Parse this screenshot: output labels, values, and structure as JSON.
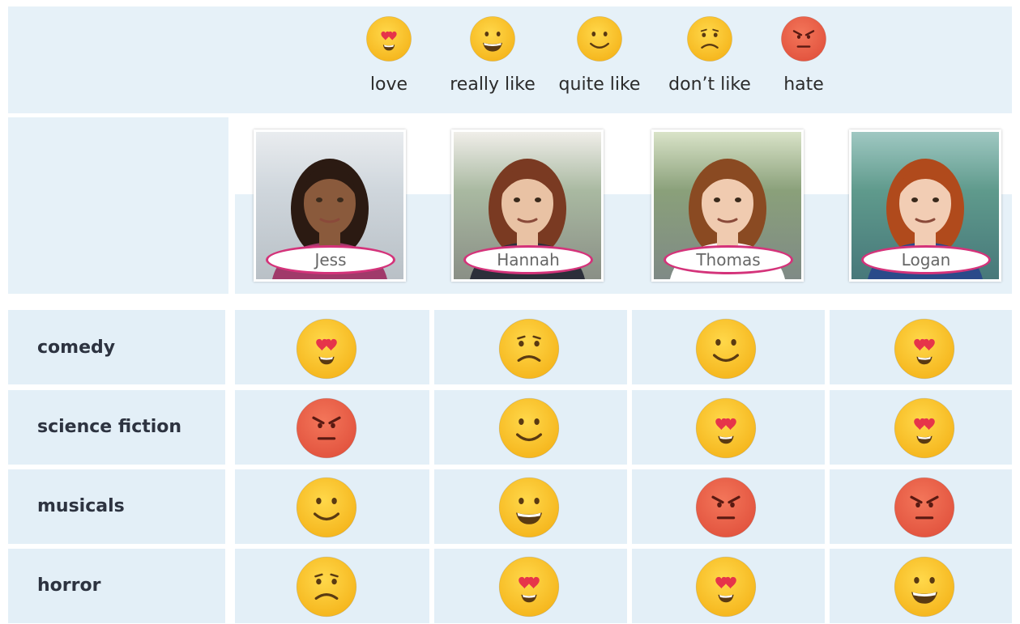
{
  "legend": [
    {
      "key": "love",
      "label": "love",
      "face": "heart-eyes-face-icon"
    },
    {
      "key": "really_like",
      "label": "really like",
      "face": "grinning-face-icon"
    },
    {
      "key": "quite_like",
      "label": "quite like",
      "face": "smiling-face-icon"
    },
    {
      "key": "dont_like",
      "label": "don’t like",
      "face": "frowning-face-icon"
    },
    {
      "key": "hate",
      "label": "hate",
      "face": "angry-face-icon"
    }
  ],
  "people": [
    {
      "name": "Jess"
    },
    {
      "name": "Hannah"
    },
    {
      "name": "Thomas"
    },
    {
      "name": "Logan"
    }
  ],
  "genres": [
    "comedy",
    "science fiction",
    "musicals",
    "horror"
  ],
  "ratings": [
    [
      "love",
      "dont_like",
      "quite_like",
      "love"
    ],
    [
      "hate",
      "quite_like",
      "love",
      "love"
    ],
    [
      "quite_like",
      "really_like",
      "hate",
      "hate"
    ],
    [
      "dont_like",
      "love",
      "love",
      "really_like"
    ]
  ],
  "colors": {
    "yellow": "#f5b51c",
    "yellow_light": "#ffd84a",
    "red": "#e2533e",
    "red_light": "#f3765a",
    "heart": "#e6344a",
    "name_border": "#d4337a",
    "panel": "#e6f1f8"
  }
}
